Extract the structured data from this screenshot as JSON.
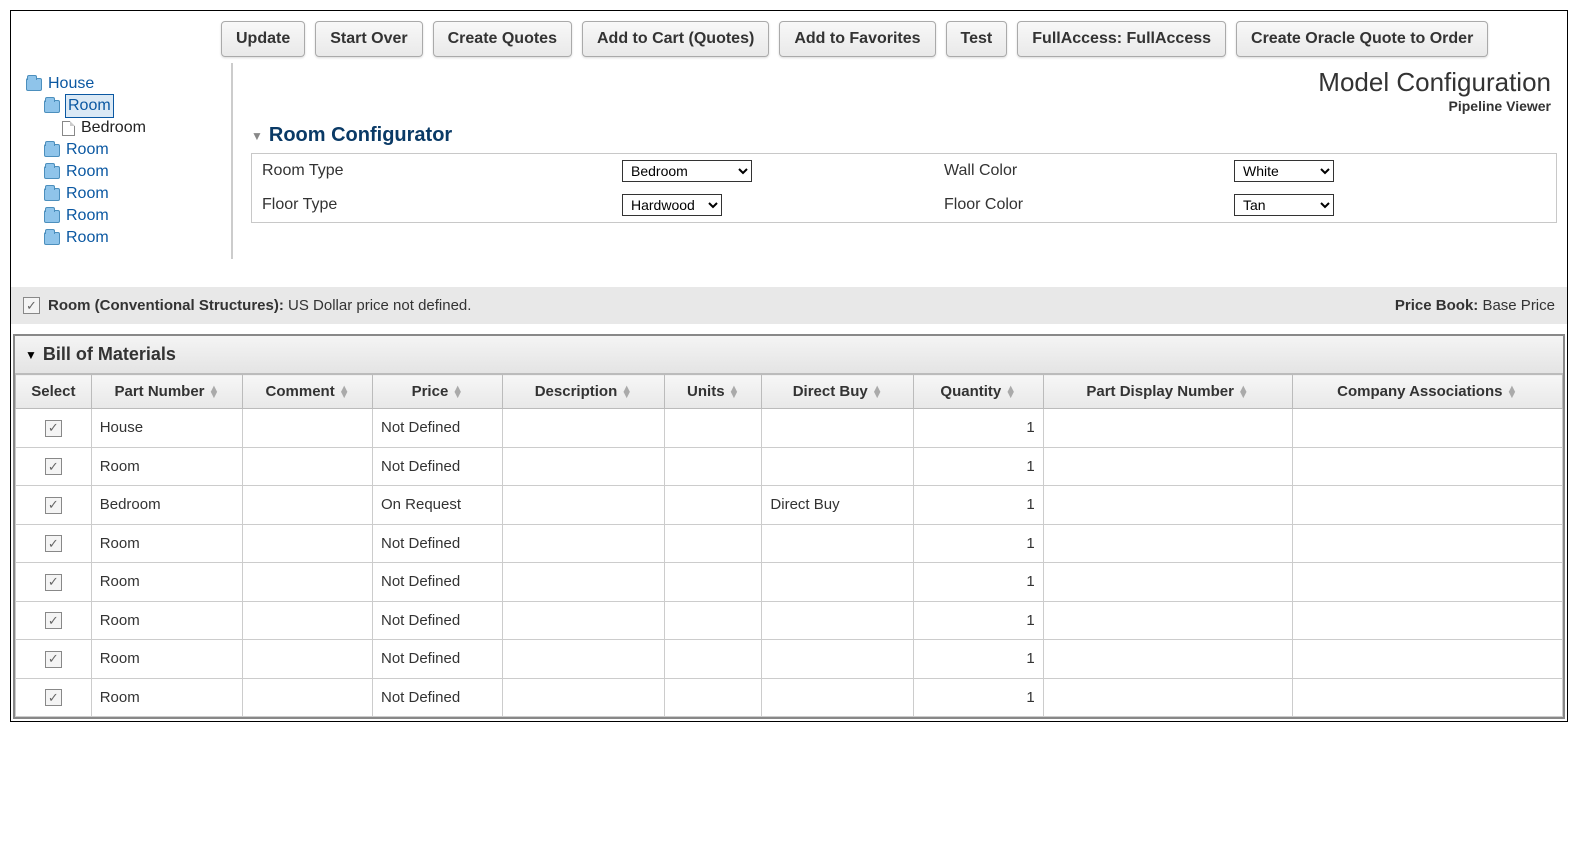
{
  "toolbar": {
    "update": "Update",
    "startOver": "Start Over",
    "createQuotes": "Create Quotes",
    "addToCart": "Add to Cart (Quotes)",
    "addFav": "Add to Favorites",
    "test": "Test",
    "fullAccess": "FullAccess: FullAccess",
    "oracleQuote": "Create Oracle Quote to Order"
  },
  "tree": {
    "root": "House",
    "selected": "Room",
    "child": "Bedroom",
    "siblings": [
      "Room",
      "Room",
      "Room",
      "Room",
      "Room"
    ]
  },
  "header": {
    "title": "Model Configuration",
    "subtitle": "Pipeline Viewer"
  },
  "section": {
    "title": "Room Configurator"
  },
  "config": {
    "roomTypeLabel": "Room Type",
    "roomTypeValue": "Bedroom",
    "wallColorLabel": "Wall Color",
    "wallColorValue": "White",
    "floorTypeLabel": "Floor Type",
    "floorTypeValue": "Hardwood",
    "floorColorLabel": "Floor Color",
    "floorColorValue": "Tan"
  },
  "status": {
    "leftBold": "Room (Conventional Structures):",
    "leftText": "US Dollar price not defined.",
    "rightBold": "Price Book:",
    "rightText": "Base Price"
  },
  "bom": {
    "title": "Bill of Materials",
    "headers": {
      "select": "Select",
      "part": "Part Number",
      "comment": "Comment",
      "price": "Price",
      "desc": "Description",
      "units": "Units",
      "direct": "Direct Buy",
      "qty": "Quantity",
      "disp": "Part Display Number",
      "comp": "Company Associations"
    },
    "rows": [
      {
        "part": "House",
        "comment": "",
        "price": "Not Defined",
        "desc": "",
        "units": "",
        "direct": "",
        "qty": "1",
        "disp": "",
        "comp": ""
      },
      {
        "part": "Room",
        "comment": "",
        "price": "Not Defined",
        "desc": "",
        "units": "",
        "direct": "",
        "qty": "1",
        "disp": "",
        "comp": ""
      },
      {
        "part": "Bedroom",
        "comment": "",
        "price": "On Request",
        "desc": "",
        "units": "",
        "direct": "Direct Buy",
        "qty": "1",
        "disp": "",
        "comp": ""
      },
      {
        "part": "Room",
        "comment": "",
        "price": "Not Defined",
        "desc": "",
        "units": "",
        "direct": "",
        "qty": "1",
        "disp": "",
        "comp": ""
      },
      {
        "part": "Room",
        "comment": "",
        "price": "Not Defined",
        "desc": "",
        "units": "",
        "direct": "",
        "qty": "1",
        "disp": "",
        "comp": ""
      },
      {
        "part": "Room",
        "comment": "",
        "price": "Not Defined",
        "desc": "",
        "units": "",
        "direct": "",
        "qty": "1",
        "disp": "",
        "comp": ""
      },
      {
        "part": "Room",
        "comment": "",
        "price": "Not Defined",
        "desc": "",
        "units": "",
        "direct": "",
        "qty": "1",
        "disp": "",
        "comp": ""
      },
      {
        "part": "Room",
        "comment": "",
        "price": "Not Defined",
        "desc": "",
        "units": "",
        "direct": "",
        "qty": "1",
        "disp": "",
        "comp": ""
      }
    ]
  }
}
